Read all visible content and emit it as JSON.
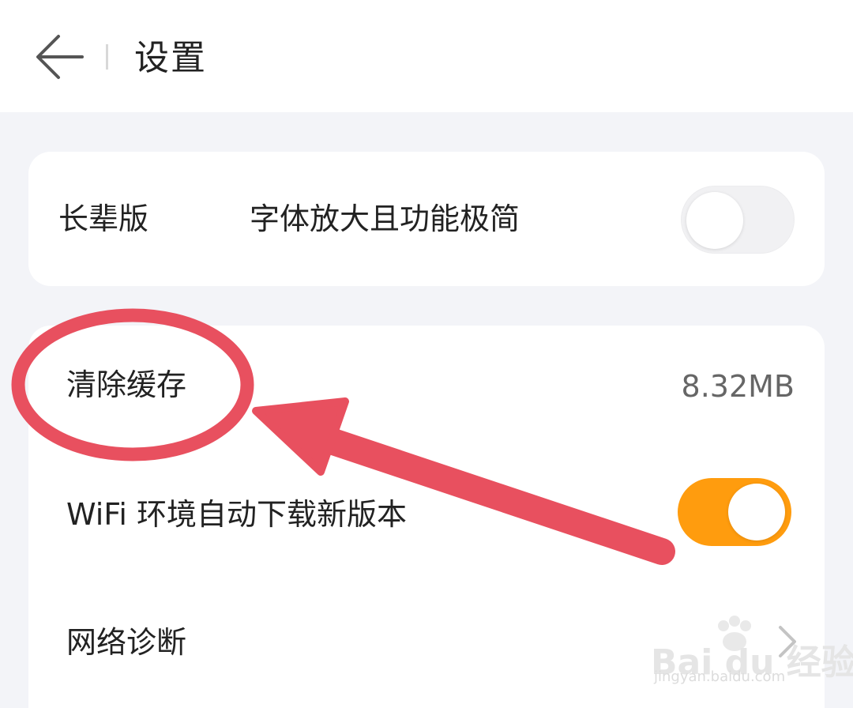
{
  "header": {
    "title": "设置",
    "back_icon": "arrow-left-icon"
  },
  "elder_mode": {
    "label": "长辈版",
    "description": "字体放大且功能极简",
    "toggle_on": false
  },
  "settings": {
    "clear_cache": {
      "label": "清除缓存",
      "value": "8.32MB"
    },
    "wifi_auto_download": {
      "label": "WiFi 环境自动下载新版本",
      "toggle_on": true
    },
    "network_diagnosis": {
      "label": "网络诊断",
      "icon": "chevron-right-icon"
    }
  },
  "annotation": {
    "color": "#e8505f"
  },
  "watermark": {
    "brand": "Bai du 经验",
    "url": "jingyan.baidu.com"
  },
  "colors": {
    "background": "#f3f4f8",
    "toggle_on": "#ff9c0e",
    "toggle_off": "#f1f1f3"
  }
}
